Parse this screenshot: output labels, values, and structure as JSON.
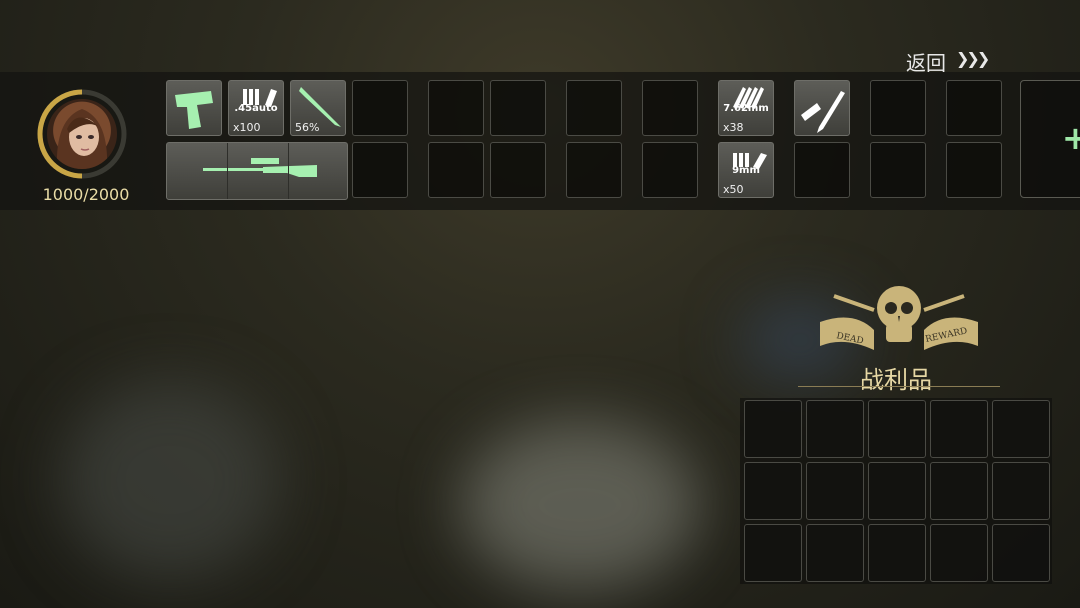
{
  "player": {
    "hp_text": "1000/2000",
    "hp_fraction": 0.5
  },
  "nav": {
    "back_label": "返回",
    "back_chevrons": "❯❯❯"
  },
  "inventory": {
    "pistol_icon": "pistol-icon",
    "ammo_45": {
      "caliber": ".45auto",
      "count": "x100"
    },
    "knife": {
      "durability": "56%"
    },
    "ammo_762": {
      "caliber": "7.62mm",
      "count": "x38"
    },
    "ammo_9mm": {
      "caliber": "9mm",
      "count": "x50"
    },
    "pen_icon": "pen-icon",
    "rifle_icon": "sniper-rifle-icon"
  },
  "loot": {
    "title": "战利品",
    "emblem_text_left": "DEAD",
    "emblem_text_right": "REWARD",
    "rows": 3,
    "cols": 5
  },
  "colors": {
    "item_green": "#a6f0b0",
    "gold": "#c9b47a",
    "ring": "#c9a646"
  }
}
